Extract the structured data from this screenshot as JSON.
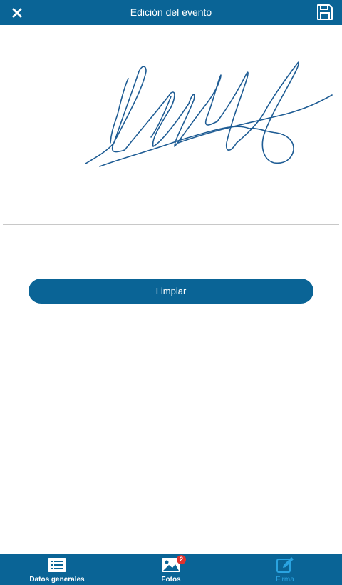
{
  "header": {
    "title": "Edición del evento",
    "close_icon": "close-icon",
    "save_icon": "floppy-disk-icon"
  },
  "actions": {
    "clear_label": "Limpiar"
  },
  "tabbar": {
    "tabs": [
      {
        "label": "Datos generales",
        "icon": "list-card-icon",
        "active": false
      },
      {
        "label": "Fotos",
        "icon": "image-icon",
        "active": false,
        "badge": "2"
      },
      {
        "label": "Firma",
        "icon": "pencil-square-icon",
        "active": true
      }
    ]
  },
  "colors": {
    "primary": "#0a6496",
    "active_tab": "#2aa3e0",
    "badge": "#e0322d",
    "signature_ink": "#1e5c94"
  }
}
